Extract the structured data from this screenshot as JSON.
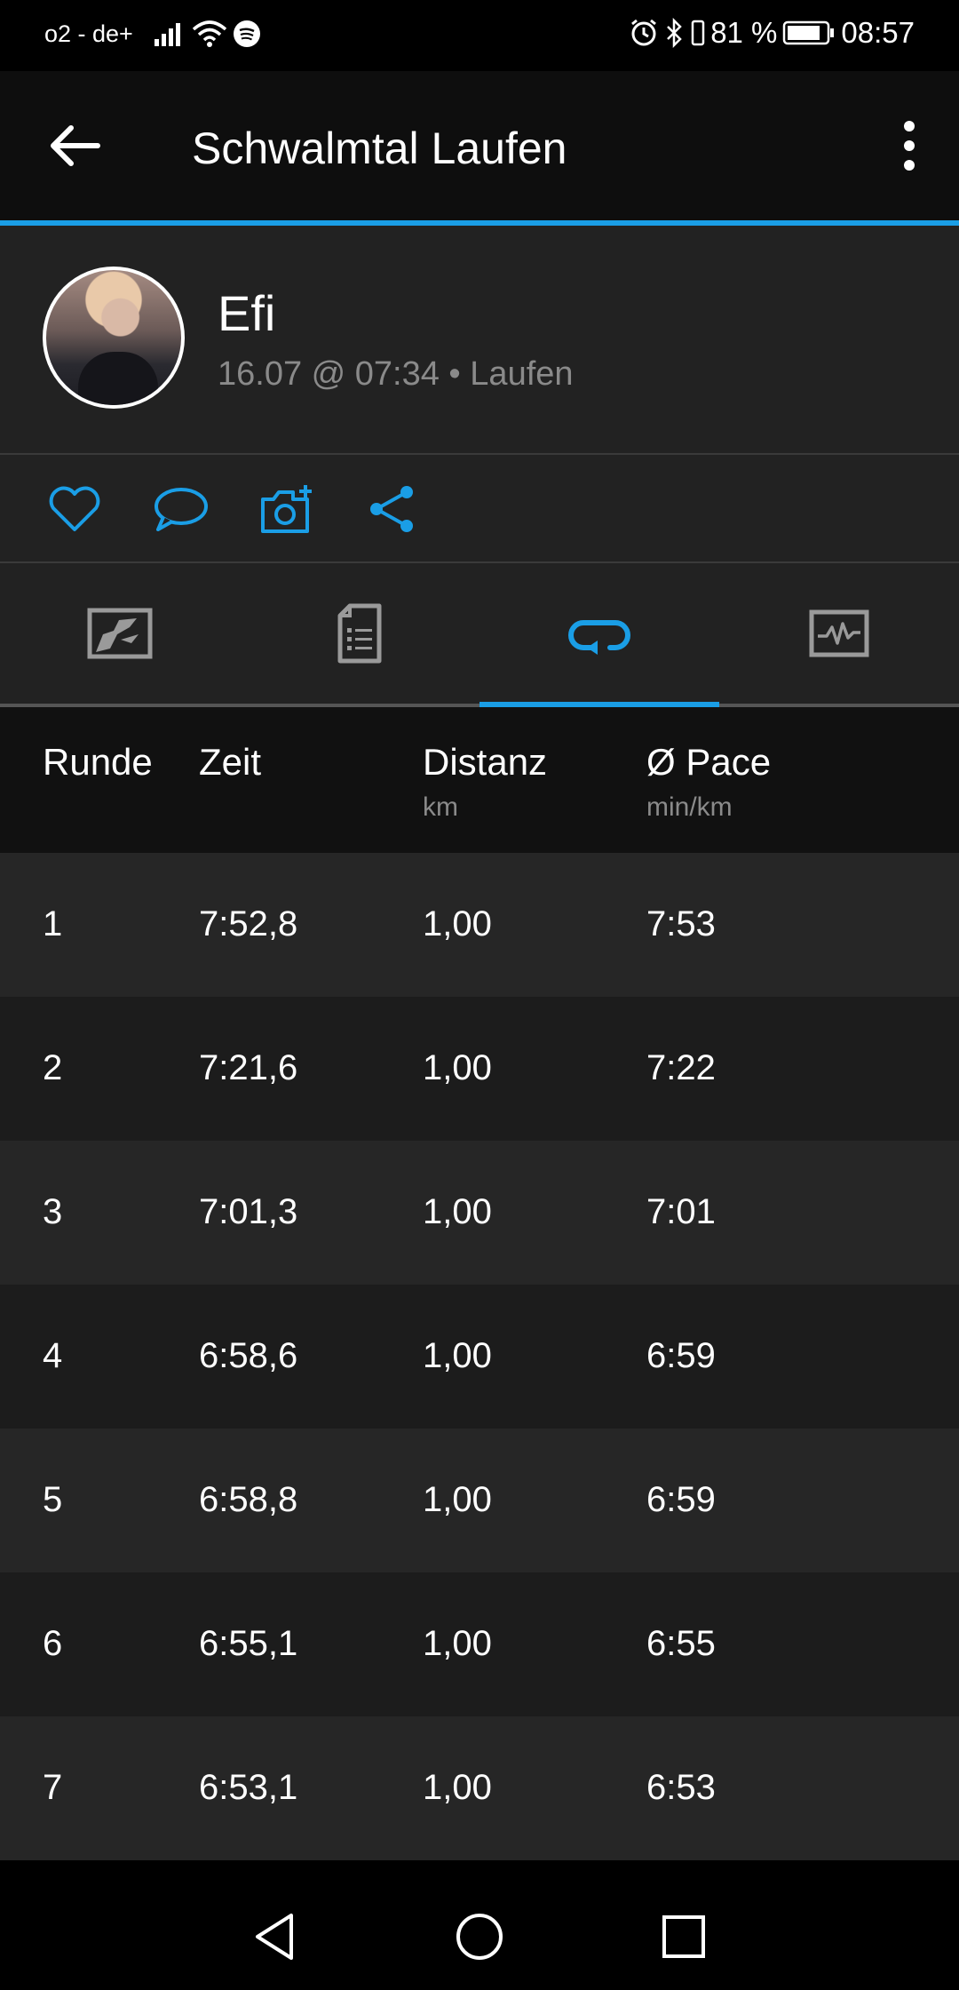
{
  "status_bar": {
    "carrier": "o2 - de+",
    "battery": "81 %",
    "time": "08:57"
  },
  "app_bar": {
    "title": "Schwalmtal Laufen"
  },
  "profile": {
    "name": "Efi",
    "meta": "16.07 @ 07:34 • Laufen"
  },
  "colors": {
    "accent": "#1a9ee6",
    "background": "#222222",
    "header_bg": "#0e0e0e"
  },
  "tabs": {
    "active_index": 2,
    "items": [
      "summary-map-icon",
      "details-list-icon",
      "laps-loop-icon",
      "chart-pulse-icon"
    ]
  },
  "table": {
    "headers": [
      {
        "label": "Runde",
        "unit": ""
      },
      {
        "label": "Zeit",
        "unit": ""
      },
      {
        "label": "Distanz",
        "unit": "km"
      },
      {
        "label": "Ø Pace",
        "unit": "min/km"
      }
    ],
    "rows": [
      [
        "1",
        "7:52,8",
        "1,00",
        "7:53"
      ],
      [
        "2",
        "7:21,6",
        "1,00",
        "7:22"
      ],
      [
        "3",
        "7:01,3",
        "1,00",
        "7:01"
      ],
      [
        "4",
        "6:58,6",
        "1,00",
        "6:59"
      ],
      [
        "5",
        "6:58,8",
        "1,00",
        "6:59"
      ],
      [
        "6",
        "6:55,1",
        "1,00",
        "6:55"
      ],
      [
        "7",
        "6:53,1",
        "1,00",
        "6:53"
      ]
    ]
  }
}
